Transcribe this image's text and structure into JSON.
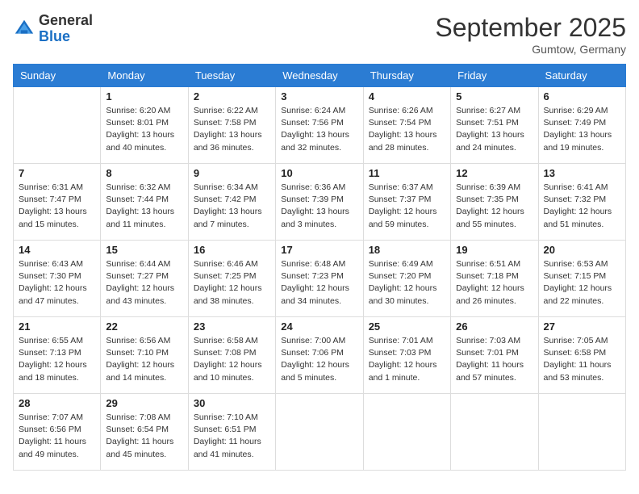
{
  "header": {
    "logo_general": "General",
    "logo_blue": "Blue",
    "month_title": "September 2025",
    "location": "Gumtow, Germany"
  },
  "columns": [
    "Sunday",
    "Monday",
    "Tuesday",
    "Wednesday",
    "Thursday",
    "Friday",
    "Saturday"
  ],
  "weeks": [
    [
      {
        "day": "",
        "info": ""
      },
      {
        "day": "1",
        "info": "Sunrise: 6:20 AM\nSunset: 8:01 PM\nDaylight: 13 hours\nand 40 minutes."
      },
      {
        "day": "2",
        "info": "Sunrise: 6:22 AM\nSunset: 7:58 PM\nDaylight: 13 hours\nand 36 minutes."
      },
      {
        "day": "3",
        "info": "Sunrise: 6:24 AM\nSunset: 7:56 PM\nDaylight: 13 hours\nand 32 minutes."
      },
      {
        "day": "4",
        "info": "Sunrise: 6:26 AM\nSunset: 7:54 PM\nDaylight: 13 hours\nand 28 minutes."
      },
      {
        "day": "5",
        "info": "Sunrise: 6:27 AM\nSunset: 7:51 PM\nDaylight: 13 hours\nand 24 minutes."
      },
      {
        "day": "6",
        "info": "Sunrise: 6:29 AM\nSunset: 7:49 PM\nDaylight: 13 hours\nand 19 minutes."
      }
    ],
    [
      {
        "day": "7",
        "info": "Sunrise: 6:31 AM\nSunset: 7:47 PM\nDaylight: 13 hours\nand 15 minutes."
      },
      {
        "day": "8",
        "info": "Sunrise: 6:32 AM\nSunset: 7:44 PM\nDaylight: 13 hours\nand 11 minutes."
      },
      {
        "day": "9",
        "info": "Sunrise: 6:34 AM\nSunset: 7:42 PM\nDaylight: 13 hours\nand 7 minutes."
      },
      {
        "day": "10",
        "info": "Sunrise: 6:36 AM\nSunset: 7:39 PM\nDaylight: 13 hours\nand 3 minutes."
      },
      {
        "day": "11",
        "info": "Sunrise: 6:37 AM\nSunset: 7:37 PM\nDaylight: 12 hours\nand 59 minutes."
      },
      {
        "day": "12",
        "info": "Sunrise: 6:39 AM\nSunset: 7:35 PM\nDaylight: 12 hours\nand 55 minutes."
      },
      {
        "day": "13",
        "info": "Sunrise: 6:41 AM\nSunset: 7:32 PM\nDaylight: 12 hours\nand 51 minutes."
      }
    ],
    [
      {
        "day": "14",
        "info": "Sunrise: 6:43 AM\nSunset: 7:30 PM\nDaylight: 12 hours\nand 47 minutes."
      },
      {
        "day": "15",
        "info": "Sunrise: 6:44 AM\nSunset: 7:27 PM\nDaylight: 12 hours\nand 43 minutes."
      },
      {
        "day": "16",
        "info": "Sunrise: 6:46 AM\nSunset: 7:25 PM\nDaylight: 12 hours\nand 38 minutes."
      },
      {
        "day": "17",
        "info": "Sunrise: 6:48 AM\nSunset: 7:23 PM\nDaylight: 12 hours\nand 34 minutes."
      },
      {
        "day": "18",
        "info": "Sunrise: 6:49 AM\nSunset: 7:20 PM\nDaylight: 12 hours\nand 30 minutes."
      },
      {
        "day": "19",
        "info": "Sunrise: 6:51 AM\nSunset: 7:18 PM\nDaylight: 12 hours\nand 26 minutes."
      },
      {
        "day": "20",
        "info": "Sunrise: 6:53 AM\nSunset: 7:15 PM\nDaylight: 12 hours\nand 22 minutes."
      }
    ],
    [
      {
        "day": "21",
        "info": "Sunrise: 6:55 AM\nSunset: 7:13 PM\nDaylight: 12 hours\nand 18 minutes."
      },
      {
        "day": "22",
        "info": "Sunrise: 6:56 AM\nSunset: 7:10 PM\nDaylight: 12 hours\nand 14 minutes."
      },
      {
        "day": "23",
        "info": "Sunrise: 6:58 AM\nSunset: 7:08 PM\nDaylight: 12 hours\nand 10 minutes."
      },
      {
        "day": "24",
        "info": "Sunrise: 7:00 AM\nSunset: 7:06 PM\nDaylight: 12 hours\nand 5 minutes."
      },
      {
        "day": "25",
        "info": "Sunrise: 7:01 AM\nSunset: 7:03 PM\nDaylight: 12 hours\nand 1 minute."
      },
      {
        "day": "26",
        "info": "Sunrise: 7:03 AM\nSunset: 7:01 PM\nDaylight: 11 hours\nand 57 minutes."
      },
      {
        "day": "27",
        "info": "Sunrise: 7:05 AM\nSunset: 6:58 PM\nDaylight: 11 hours\nand 53 minutes."
      }
    ],
    [
      {
        "day": "28",
        "info": "Sunrise: 7:07 AM\nSunset: 6:56 PM\nDaylight: 11 hours\nand 49 minutes."
      },
      {
        "day": "29",
        "info": "Sunrise: 7:08 AM\nSunset: 6:54 PM\nDaylight: 11 hours\nand 45 minutes."
      },
      {
        "day": "30",
        "info": "Sunrise: 7:10 AM\nSunset: 6:51 PM\nDaylight: 11 hours\nand 41 minutes."
      },
      {
        "day": "",
        "info": ""
      },
      {
        "day": "",
        "info": ""
      },
      {
        "day": "",
        "info": ""
      },
      {
        "day": "",
        "info": ""
      }
    ]
  ]
}
